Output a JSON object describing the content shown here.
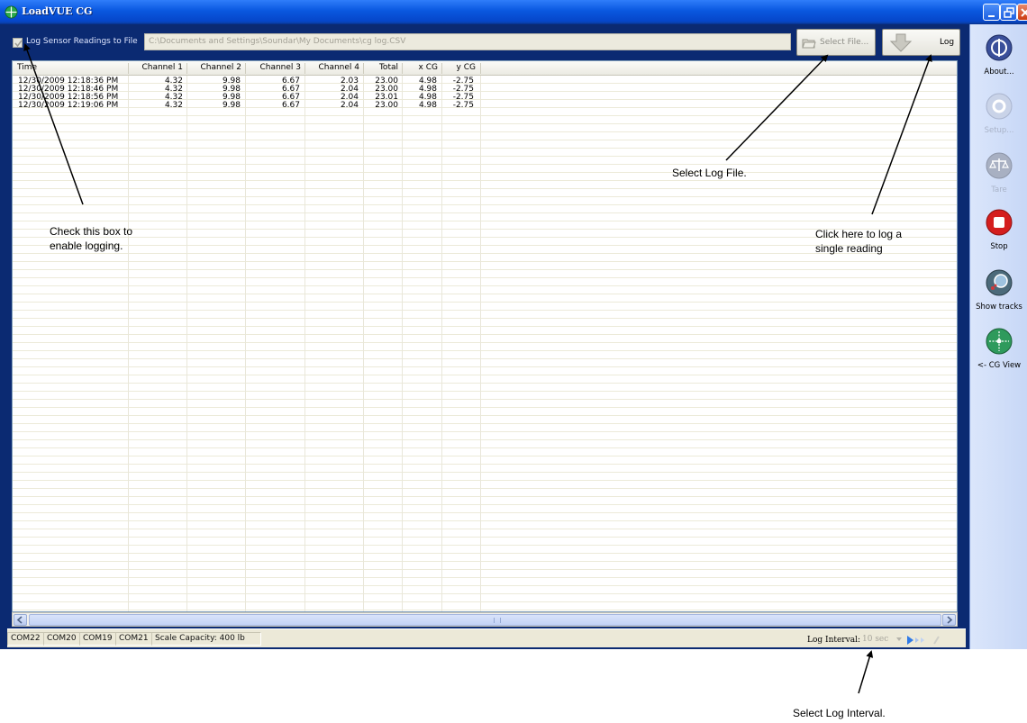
{
  "window": {
    "title": "LoadVUE CG",
    "colors": {
      "titlebar": "#0a58e0",
      "frame": "#0b2a72",
      "toolbar": "#c7d7f6"
    }
  },
  "log_bar": {
    "checkbox_label": "Log Sensor Readings to File",
    "checked": true,
    "file_path": "C:\\Documents and Settings\\Soundar\\My Documents\\cg log.CSV",
    "select_file_label": "Select File...",
    "log_label": "Log"
  },
  "grid": {
    "columns": [
      "Time",
      "Channel 1",
      "Channel 2",
      "Channel 3",
      "Channel 4",
      "Total",
      "x CG",
      "y CG"
    ],
    "rows": [
      [
        "12/30/2009 12:18:36 PM",
        "4.32",
        "9.98",
        "6.67",
        "2.03",
        "23.00",
        "4.98",
        "-2.75"
      ],
      [
        "12/30/2009 12:18:46 PM",
        "4.32",
        "9.98",
        "6.67",
        "2.04",
        "23.00",
        "4.98",
        "-2.75"
      ],
      [
        "12/30/2009 12:18:56 PM",
        "4.32",
        "9.98",
        "6.67",
        "2.04",
        "23.01",
        "4.98",
        "-2.75"
      ],
      [
        "12/30/2009 12:19:06 PM",
        "4.32",
        "9.98",
        "6.67",
        "2.04",
        "23.00",
        "4.98",
        "-2.75"
      ]
    ]
  },
  "status_bar": {
    "ports": [
      "COM22",
      "COM20",
      "COM19",
      "COM21"
    ],
    "scale_capacity": "Scale Capacity:  400 lb",
    "log_interval_label": "Log Interval:",
    "log_interval_value": "10 sec"
  },
  "toolbar": {
    "items": [
      {
        "label": "About...",
        "icon": "about-icon",
        "enabled": true,
        "color": "#3a4f9a"
      },
      {
        "label": "Setup...",
        "icon": "gear-icon",
        "enabled": false,
        "color": "#b6c1d8"
      },
      {
        "label": "Tare",
        "icon": "scale-icon",
        "enabled": false,
        "color": "#9aa3b6"
      },
      {
        "label": "Stop",
        "icon": "stop-icon",
        "enabled": true,
        "color": "#d41e1e"
      },
      {
        "label": "Show tracks",
        "icon": "tracks-icon",
        "enabled": true,
        "color": "#4b6a7a"
      },
      {
        "label": "<- CG View",
        "icon": "crosshair-icon",
        "enabled": true,
        "color": "#2e9a5c"
      }
    ]
  },
  "annotations": {
    "checkbox_note": "Check this box to\nenable logging.",
    "select_file_note": "Select Log File.",
    "log_note": "Click here to log a\nsingle reading",
    "interval_note": "Select Log Interval."
  }
}
